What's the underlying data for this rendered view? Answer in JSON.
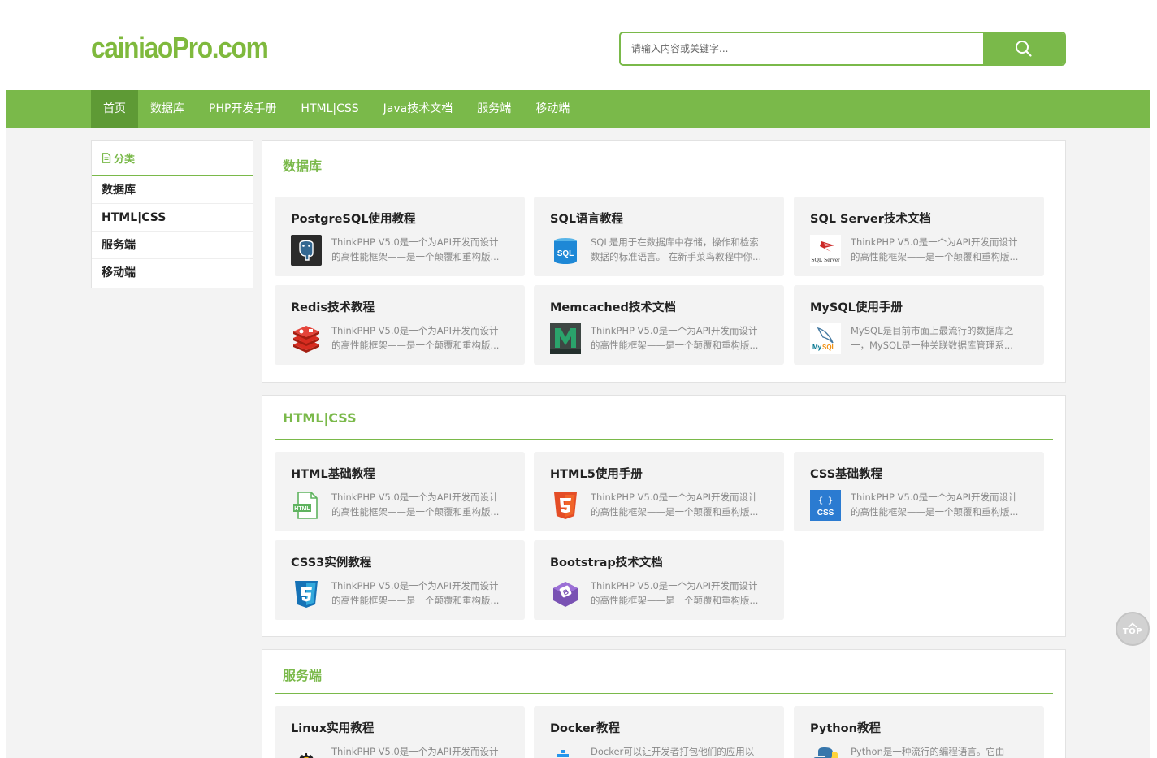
{
  "header": {
    "logo": "cainiaoPro.com",
    "search_placeholder": "请输入内容或关键字...",
    "search_icon": "search-icon"
  },
  "nav": {
    "items": [
      "首页",
      "数据库",
      "PHP开发手册",
      "HTML|CSS",
      "Java技术文档",
      "服务端",
      "移动端"
    ],
    "active": "首页"
  },
  "sidebar": {
    "title": "分类",
    "title_icon": "document-icon",
    "items": [
      "数据库",
      "HTML|CSS",
      "服务端",
      "移动端"
    ]
  },
  "sections": [
    {
      "title": "数据库",
      "cards": [
        {
          "title": "PostgreSQL使用教程",
          "icon": "postgresql-icon",
          "desc1": "ThinkPHP V5.0是一个为API开发而设计",
          "desc2": "的高性能框架——是一个颠覆和重构版..."
        },
        {
          "title": "SQL语言教程",
          "icon": "sql-icon",
          "desc1": "SQL是用于在数据库中存储，操作和检索",
          "desc2": "数据的标准语言。 在新手菜鸟教程中你..."
        },
        {
          "title": "SQL Server技术文档",
          "icon": "sql-server-icon",
          "desc1": "ThinkPHP V5.0是一个为API开发而设计",
          "desc2": "的高性能框架——是一个颠覆和重构版..."
        },
        {
          "title": "Redis技术教程",
          "icon": "redis-icon",
          "desc1": "ThinkPHP V5.0是一个为API开发而设计",
          "desc2": "的高性能框架——是一个颠覆和重构版..."
        },
        {
          "title": "Memcached技术文档",
          "icon": "memcached-icon",
          "desc1": "ThinkPHP V5.0是一个为API开发而设计",
          "desc2": "的高性能框架——是一个颠覆和重构版..."
        },
        {
          "title": "MySQL使用手册",
          "icon": "mysql-icon",
          "desc1": "MySQL是目前市面上最流行的数据库之",
          "desc2": "一，MySQL是一种关联数据库管理系..."
        }
      ]
    },
    {
      "title": "HTML|CSS",
      "cards": [
        {
          "title": "HTML基础教程",
          "icon": "html-file-icon",
          "desc1": "ThinkPHP V5.0是一个为API开发而设计",
          "desc2": "的高性能框架——是一个颠覆和重构版..."
        },
        {
          "title": "HTML5使用手册",
          "icon": "html5-icon",
          "desc1": "ThinkPHP V5.0是一个为API开发而设计",
          "desc2": "的高性能框架——是一个颠覆和重构版..."
        },
        {
          "title": "CSS基础教程",
          "icon": "css-icon",
          "desc1": "ThinkPHP V5.0是一个为API开发而设计",
          "desc2": "的高性能框架——是一个颠覆和重构版..."
        },
        {
          "title": "CSS3实例教程",
          "icon": "css3-icon",
          "desc1": "ThinkPHP V5.0是一个为API开发而设计",
          "desc2": "的高性能框架——是一个颠覆和重构版..."
        },
        {
          "title": "Bootstrap技术文档",
          "icon": "bootstrap-icon",
          "desc1": "ThinkPHP V5.0是一个为API开发而设计",
          "desc2": "的高性能框架——是一个颠覆和重构版..."
        }
      ]
    },
    {
      "title": "服务端",
      "cards": [
        {
          "title": "Linux实用教程",
          "icon": "linux-icon",
          "desc1": "ThinkPHP V5.0是一个为API开发而设计",
          "desc2": ""
        },
        {
          "title": "Docker教程",
          "icon": "docker-icon",
          "desc1": "Docker可以让开发者打包他们的应用以",
          "desc2": ""
        },
        {
          "title": "Python教程",
          "icon": "python-icon",
          "desc1": "Python是一种流行的编程语言。它由",
          "desc2": ""
        }
      ]
    }
  ],
  "back_to_top": {
    "label": "TOP",
    "icon": "chevron-up-icon"
  },
  "colors": {
    "accent": "#7ab94a",
    "accent_dark": "#5e9a35",
    "logo": "#7fb93d"
  }
}
